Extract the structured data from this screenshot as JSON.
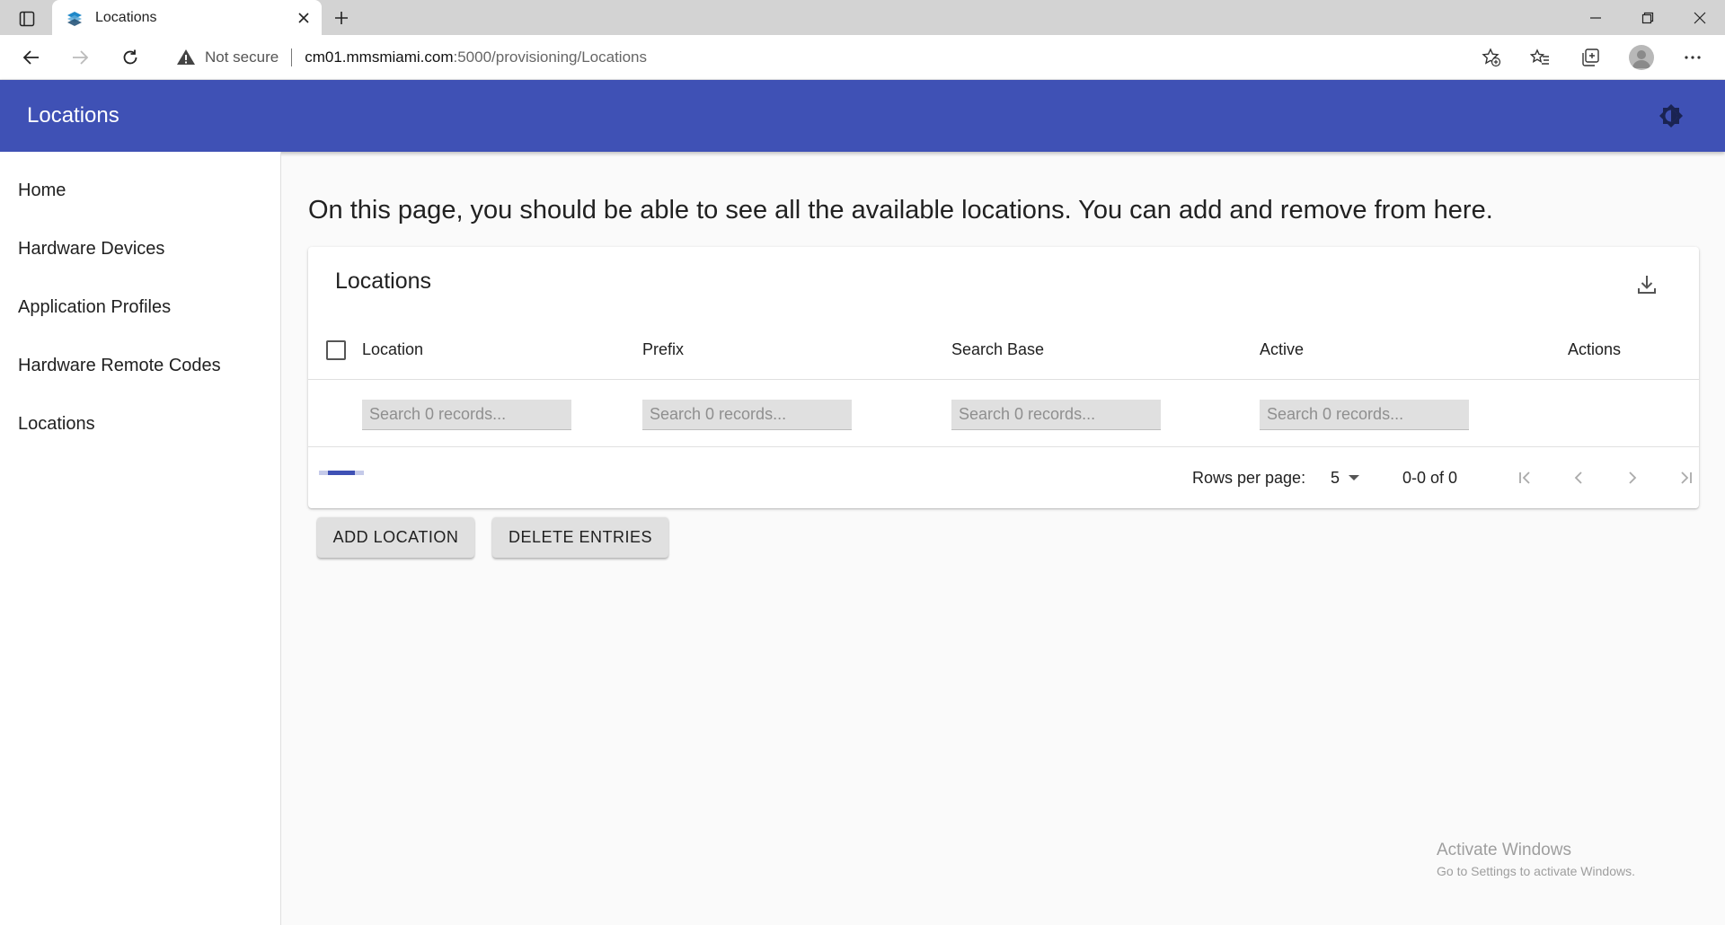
{
  "browser": {
    "tab_title": "Locations",
    "security_label": "Not secure",
    "url_host": "cm01.mmsmiami.com",
    "url_path": ":5000/provisioning/Locations"
  },
  "appbar": {
    "title": "Locations"
  },
  "sidebar": {
    "items": [
      {
        "label": "Home"
      },
      {
        "label": "Hardware Devices"
      },
      {
        "label": "Application Profiles"
      },
      {
        "label": "Hardware Remote Codes"
      },
      {
        "label": "Locations"
      }
    ]
  },
  "main": {
    "intro": "On this page, you should be able to see all the available locations. You can add and remove from here.",
    "table": {
      "title": "Locations",
      "columns": [
        "Location",
        "Prefix",
        "Search Base",
        "Active",
        "Actions"
      ],
      "filter_placeholder": "Search 0 records...",
      "rows_per_page_label": "Rows per page:",
      "rows_per_page_value": "5",
      "page_range": "0-0 of 0"
    },
    "buttons": {
      "add": "ADD LOCATION",
      "delete": "DELETE ENTRIES"
    }
  },
  "watermark": {
    "title": "Activate Windows",
    "subtitle": "Go to Settings to activate Windows."
  },
  "colors": {
    "primary": "#3f51b5",
    "appbar_text": "#ffffff"
  },
  "icons": [
    "tab-actions-icon",
    "app-favicon",
    "close-icon",
    "plus-icon",
    "minimize-icon",
    "restore-icon",
    "back-arrow-icon",
    "forward-arrow-icon",
    "refresh-icon",
    "warning-icon",
    "add-favorite-icon",
    "favorites-icon",
    "collections-icon",
    "profile-avatar",
    "more-icon",
    "brightness-icon",
    "download-icon",
    "first-page-icon",
    "previous-page-icon",
    "next-page-icon",
    "last-page-icon"
  ]
}
